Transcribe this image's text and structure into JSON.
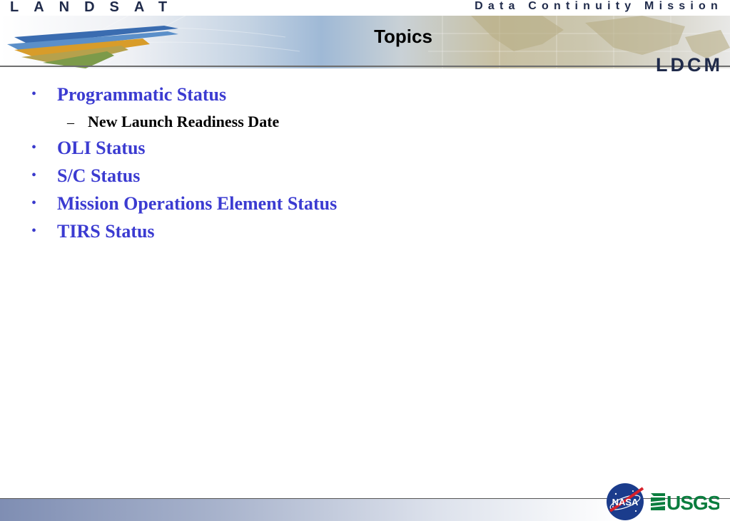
{
  "header": {
    "left_brand": "LANDSAT",
    "right_brand": "Data Continuity Mission",
    "mission_logo": "LDCM"
  },
  "slide": {
    "title": "Topics",
    "bullets": [
      {
        "label": "Programmatic Status",
        "sub": [
          "New Launch Readiness Date"
        ]
      },
      {
        "label": "OLI Status"
      },
      {
        "label": "S/C Status"
      },
      {
        "label": "Mission Operations Element Status"
      },
      {
        "label": "TIRS Status"
      }
    ]
  },
  "footer": {
    "logos": [
      "NASA",
      "USGS"
    ]
  },
  "colors": {
    "bullet_text": "#3b3bd1",
    "brand_navy": "#1f2a4a"
  }
}
